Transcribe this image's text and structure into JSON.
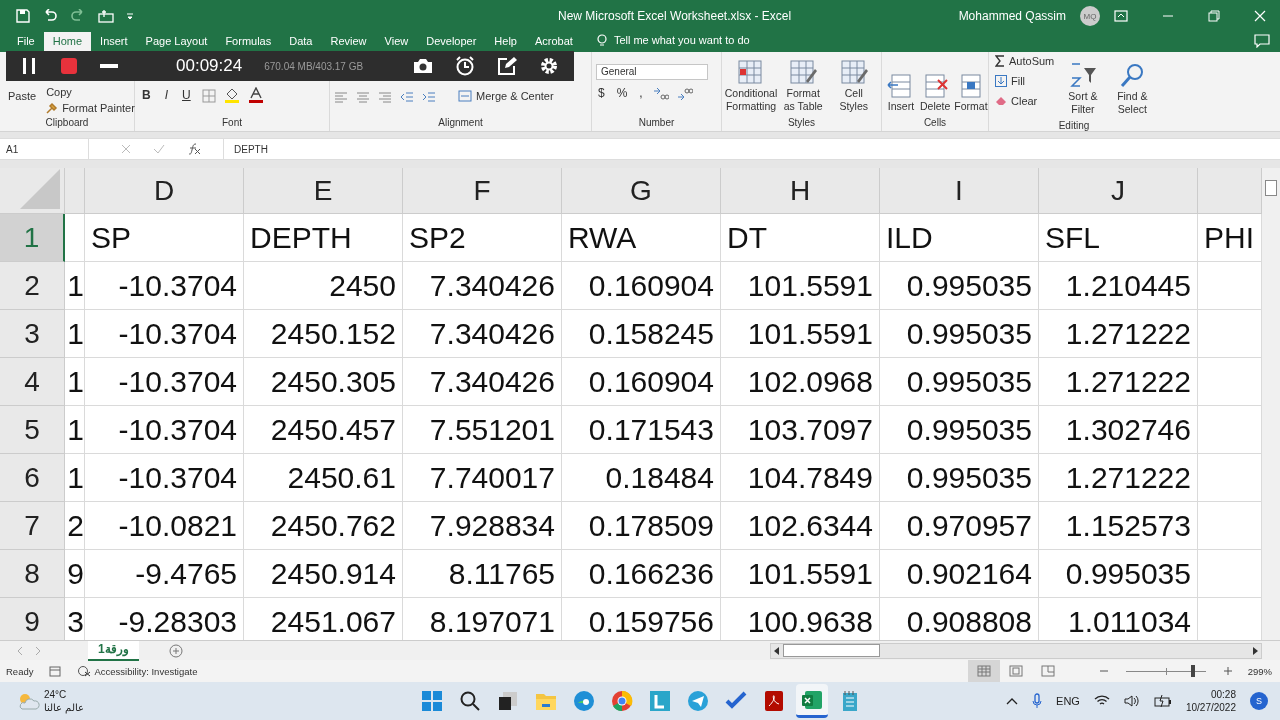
{
  "window": {
    "title": "New Microsoft Excel Worksheet.xlsx  -  Excel",
    "user": "Mohammed Qassim",
    "avatar": "MQ"
  },
  "tabs": [
    {
      "label": "File",
      "selected": false
    },
    {
      "label": "Home",
      "selected": true
    },
    {
      "label": "Insert",
      "selected": false
    },
    {
      "label": "Page Layout",
      "selected": false
    },
    {
      "label": "Formulas",
      "selected": false
    },
    {
      "label": "Data",
      "selected": false
    },
    {
      "label": "Review",
      "selected": false
    },
    {
      "label": "View",
      "selected": false
    },
    {
      "label": "Developer",
      "selected": false
    },
    {
      "label": "Help",
      "selected": false
    },
    {
      "label": "Acrobat",
      "selected": false
    }
  ],
  "tell_me": "Tell me what you want to do",
  "recorder": {
    "time": "00:09:24",
    "storage": "670.04 MB/403.17 GB"
  },
  "ribbon": {
    "clipboard": {
      "label": "Clipboard",
      "paste": "Paste",
      "copy": "Copy",
      "format_painter": "Format Painter"
    },
    "font": {
      "label": "Font",
      "bold": "B",
      "italic": "I",
      "underline": "U"
    },
    "alignment": {
      "label": "Alignment",
      "merge": "Merge & Center"
    },
    "number": {
      "label": "Number",
      "format": "General",
      "currency": "$",
      "percent": "%",
      "comma": ","
    },
    "styles": {
      "label": "Styles",
      "buttons": [
        "Conditional Formatting",
        "Format as Table",
        "Cell Styles"
      ]
    },
    "cells": {
      "label": "Cells",
      "buttons": [
        "Insert",
        "Delete",
        "Format"
      ]
    },
    "editing": {
      "label": "Editing",
      "autosum": "AutoSum",
      "fill": "Fill",
      "clear": "Clear",
      "sort": "Sort & Filter",
      "find": "Find & Select"
    }
  },
  "formula_bar": {
    "name_box": "A1",
    "formula": "DEPTH"
  },
  "grid": {
    "columns": [
      "D",
      "E",
      "F",
      "G",
      "H",
      "I",
      "J"
    ],
    "rows": [
      {
        "number": "1",
        "selected": true,
        "cells": [
          "SP",
          "DEPTH",
          "SP2",
          "RWA",
          "DT",
          "ILD",
          "SFL",
          "PHI"
        ]
      },
      {
        "number": "2",
        "selected": false,
        "cut": "1",
        "cells": [
          "-10.3704",
          "2450",
          "7.340426",
          "0.160904",
          "101.5591",
          "0.995035",
          "1.210445"
        ]
      },
      {
        "number": "3",
        "selected": false,
        "cut": "1",
        "cells": [
          "-10.3704",
          "2450.152",
          "7.340426",
          "0.158245",
          "101.5591",
          "0.995035",
          "1.271222"
        ]
      },
      {
        "number": "4",
        "selected": false,
        "cut": "1",
        "cells": [
          "-10.3704",
          "2450.305",
          "7.340426",
          "0.160904",
          "102.0968",
          "0.995035",
          "1.271222"
        ]
      },
      {
        "number": "5",
        "selected": false,
        "cut": "1",
        "cells": [
          "-10.3704",
          "2450.457",
          "7.551201",
          "0.171543",
          "103.7097",
          "0.995035",
          "1.302746"
        ]
      },
      {
        "number": "6",
        "selected": false,
        "cut": "1",
        "cells": [
          "-10.3704",
          "2450.61",
          "7.740017",
          "0.18484",
          "104.7849",
          "0.995035",
          "1.271222"
        ]
      },
      {
        "number": "7",
        "selected": false,
        "cut": "2",
        "cells": [
          "-10.0821",
          "2450.762",
          "7.928834",
          "0.178509",
          "102.6344",
          "0.970957",
          "1.152573"
        ]
      },
      {
        "number": "8",
        "selected": false,
        "cut": "9",
        "cells": [
          "-9.4765",
          "2450.914",
          "8.11765",
          "0.166236",
          "101.5591",
          "0.902164",
          "0.995035"
        ]
      },
      {
        "number": "9",
        "selected": false,
        "cut": "3",
        "cells": [
          "-9.28303",
          "2451.067",
          "8.197071",
          "0.159756",
          "100.9638",
          "0.908808",
          "1.011034"
        ]
      }
    ]
  },
  "sheets": [
    {
      "label": "ورقة1",
      "selected": true
    }
  ],
  "status": {
    "ready": "Ready",
    "accessibility": "Accessibility: Investigate",
    "views": [
      {
        "selected": true
      },
      {
        "selected": false
      },
      {
        "selected": false
      }
    ],
    "zoom": {
      "level": 0.82
    },
    "zoom_text": "299%"
  },
  "taskbar": {
    "temperature": "24°C",
    "weather_text": "عالم عالنا",
    "apps": [
      {
        "kind": "windows",
        "active": false
      },
      {
        "kind": "search",
        "active": false
      },
      {
        "kind": "taskview",
        "active": false
      },
      {
        "kind": "folder",
        "active": false
      },
      {
        "kind": "edge",
        "active": false
      },
      {
        "kind": "chrome",
        "active": false
      },
      {
        "kind": "lapp",
        "active": false
      },
      {
        "kind": "telegram",
        "active": false
      },
      {
        "kind": "todo",
        "active": false
      },
      {
        "kind": "pdf",
        "active": false
      },
      {
        "kind": "excel",
        "active": true
      },
      {
        "kind": "notepad",
        "active": false
      }
    ],
    "language": "ENG",
    "time": "00:28",
    "date": "10/27/2022",
    "notification": "S"
  }
}
